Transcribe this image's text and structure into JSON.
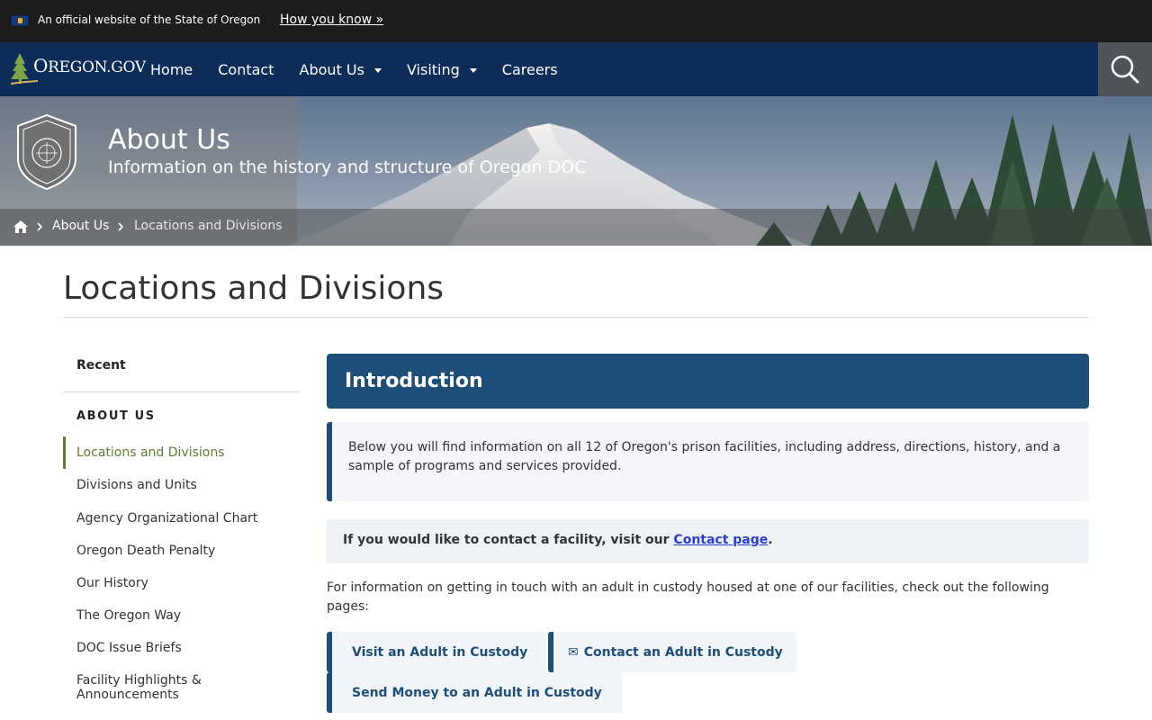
{
  "gov_banner": {
    "text": "An official website of the State of Oregon",
    "link": "How you know »"
  },
  "logo": {
    "text_big": "O",
    "text_rest": "REGON.GOV"
  },
  "nav": {
    "items": [
      {
        "label": "Home",
        "dropdown": false
      },
      {
        "label": "Contact",
        "dropdown": false
      },
      {
        "label": "About Us",
        "dropdown": true
      },
      {
        "label": "Visiting",
        "dropdown": true
      },
      {
        "label": "Careers",
        "dropdown": false
      }
    ],
    "search_icon": "search-icon"
  },
  "hero": {
    "title": "About Us",
    "subtitle": "Information on the history and structure of Oregon DOC",
    "seal_icon": "oregon-doc-seal-logo"
  },
  "breadcrumb": {
    "home_icon": "home-icon",
    "items": [
      "About Us",
      "Locations and Divisions"
    ]
  },
  "page": {
    "title": "Locations and Divisions"
  },
  "sidebar": {
    "recent": "Recent",
    "heading": "ABOUT US",
    "items": [
      "Locations and Divisions",
      "Divisions and Units",
      "Agency Organizational Chart",
      "Oregon Death Penalty",
      "Our History",
      "The Oregon Way",
      "DOC Issue Briefs",
      "Facility Highlights & Announcements"
    ],
    "active_index": 0
  },
  "main": {
    "intro_title": "Introduction",
    "callout": "Below you will find information on all 12 of Oregon's prison facilities, including address, directions, history, and a sample of programs and services provided.",
    "notice_prefix": "If you would like to contact a facility, visit our ",
    "notice_link": "Contact page",
    "notice_suffix": ".",
    "paragraph": "For information on getting in touch with an adult in custody housed at one of our facilities, check out the following pages:",
    "pills": [
      {
        "icon": "",
        "label": "Visit an Adult in Custody"
      },
      {
        "icon": "✉",
        "label": "Contact an Adult in Custody"
      },
      {
        "icon": "",
        "label": "Send Money to an Adult in Custody"
      }
    ]
  },
  "colors": {
    "banner_bg": "#1c1c1c",
    "nav_bg": "#0d2d58",
    "accent_blue": "#1f4e79",
    "active_green": "#5e7d32",
    "link_blue": "#2b40c9"
  }
}
